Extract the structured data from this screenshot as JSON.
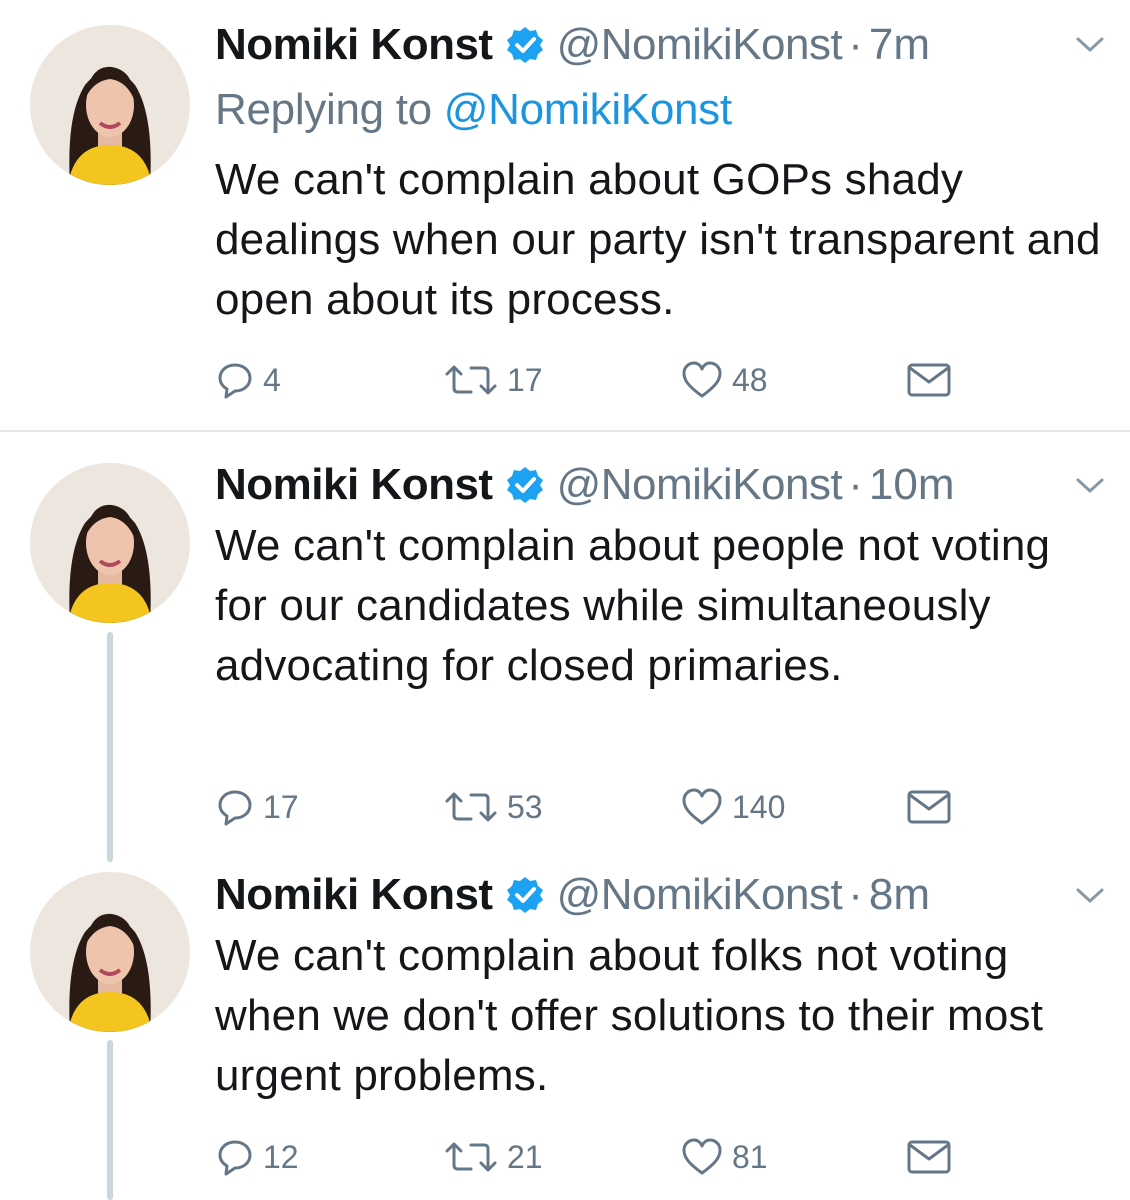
{
  "tweets": [
    {
      "author_name": "Nomiki Konst",
      "handle": "@NomikiKonst",
      "separator": "·",
      "time": "7m",
      "replying_label": "Replying to",
      "replying_to": "@NomikiKonst",
      "text": "We can't complain about GOPs shady dealings when our party isn't transparent and open about its process.",
      "replies": "4",
      "retweets": "17",
      "likes": "48"
    },
    {
      "author_name": "Nomiki Konst",
      "handle": "@NomikiKonst",
      "separator": "·",
      "time": "10m",
      "text": "We can't complain about people not voting for our candidates while simultaneously advocating for closed primaries.",
      "replies": "17",
      "retweets": "53",
      "likes": "140"
    },
    {
      "author_name": "Nomiki Konst",
      "handle": "@NomikiKonst",
      "separator": "·",
      "time": "8m",
      "text": "We can't complain about folks not voting when we don't offer solutions to their most urgent problems.",
      "replies": "12",
      "retweets": "21",
      "likes": "81"
    }
  ],
  "icons": {
    "avatar": "avatar-photo",
    "verified": "verified-badge-icon",
    "menu": "chevron-down-icon",
    "reply": "reply-bubble-icon",
    "retweet": "retweet-icon",
    "like": "heart-icon",
    "dm": "envelope-icon"
  },
  "colors": {
    "text": "#14171a",
    "secondary": "#657786",
    "accent": "#1b95e0",
    "verified": "#1da1f2",
    "divider": "#e1e8ed",
    "thread_line": "#ccd6dd"
  }
}
